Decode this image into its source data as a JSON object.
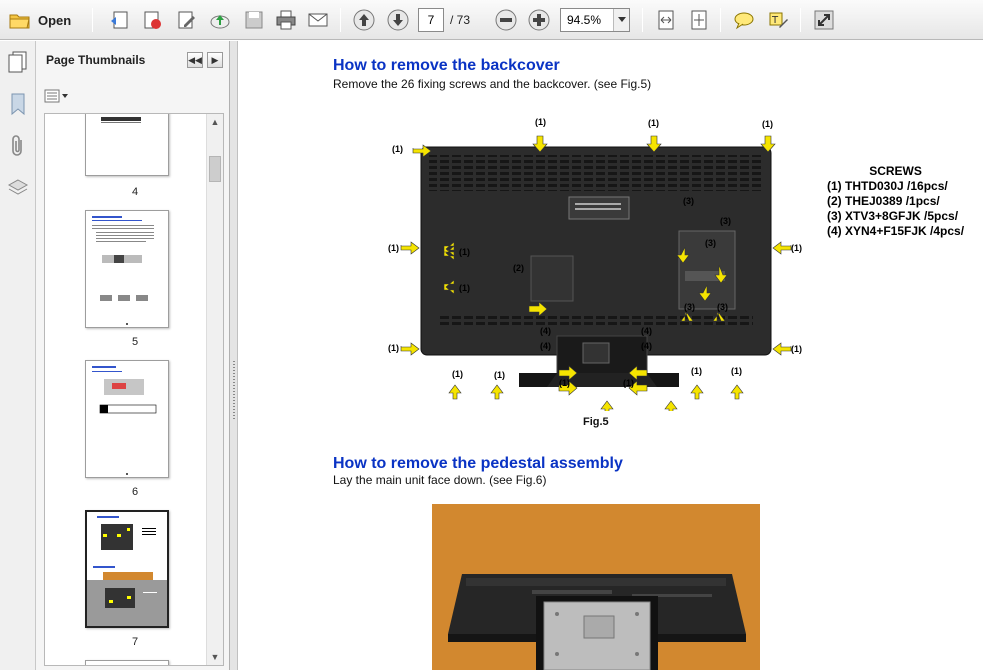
{
  "toolbar": {
    "open_label": "Open",
    "current_page": "7",
    "page_total": "/ 73",
    "zoom": "94.5%"
  },
  "thumbnails": {
    "title": "Page Thumbnails",
    "pages": [
      "4",
      "5",
      "6",
      "7"
    ]
  },
  "document": {
    "section1_heading": "How to remove the backcover",
    "section1_text": "Remove the 26 fixing screws and the backcover. (see Fig.5)",
    "figure_caption": "Fig.5",
    "screws_title": "SCREWS",
    "screws": [
      "(1) THTD030J /16pcs/",
      "(2) THEJ0389 /1pcs/",
      "(3) XTV3+8GFJK /5pcs/",
      "(4) XYN4+F15FJK /4pcs/"
    ],
    "callouts": [
      "(1)",
      "(2)",
      "(3)",
      "(4)"
    ],
    "section2_heading": "How to remove the pedestal assembly",
    "section2_text": "Lay the main unit face down. (see Fig.6)"
  },
  "colors": {
    "heading_blue": "#0a33c4",
    "arrow_yellow": "#f5e400",
    "tv_body": "#2a2a2a",
    "photo_background": "#d2882f"
  }
}
